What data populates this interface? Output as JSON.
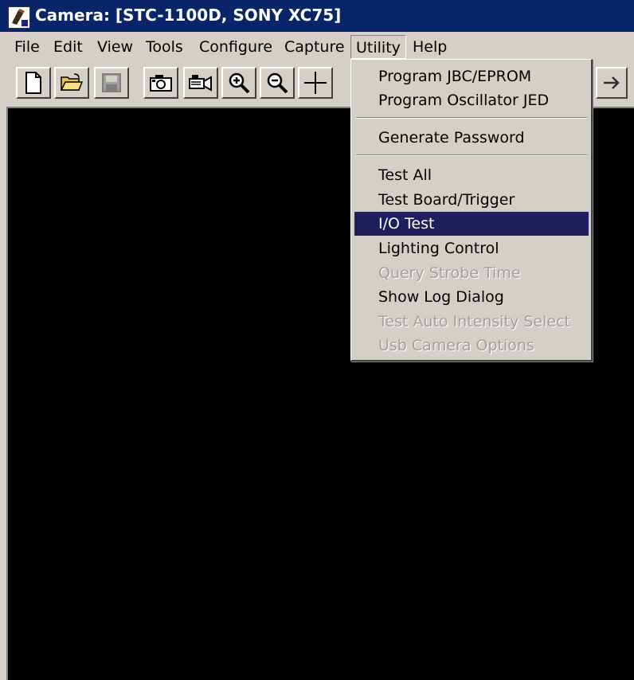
{
  "window": {
    "title": "Camera: [STC-1100D, SONY XC75]"
  },
  "menubar": {
    "items": [
      "File",
      "Edit",
      "View",
      "Tools",
      "Configure",
      "Capture",
      "Utility",
      "Help"
    ],
    "open_menu": "Utility"
  },
  "toolbar": {
    "buttons": [
      "new-icon",
      "open-folder-icon",
      "save-icon",
      "camera-snapshot-icon",
      "camera-video-icon",
      "zoom-in-icon",
      "zoom-out-icon",
      "crosshair-icon",
      "arrow-right-icon"
    ]
  },
  "utility_menu": {
    "items": [
      {
        "label": "Program JBC/EPROM",
        "enabled": true
      },
      {
        "label": "Program Oscillator JED",
        "enabled": true
      },
      {
        "label": "Generate Password",
        "enabled": true
      },
      {
        "label": "Test All",
        "enabled": true
      },
      {
        "label": "Test Board/Trigger",
        "enabled": true
      },
      {
        "label": "I/O Test",
        "enabled": true,
        "selected": true
      },
      {
        "label": "Lighting Control",
        "enabled": true
      },
      {
        "label": "Query Strobe Time",
        "enabled": false
      },
      {
        "label": "Show Log Dialog",
        "enabled": true
      },
      {
        "label": "Test Auto Intensity Select",
        "enabled": false
      },
      {
        "label": "Usb Camera Options",
        "enabled": false
      }
    ]
  },
  "colors": {
    "title_bar": "#0a246a",
    "menu_selection": "#1f1f5e",
    "window_face": "#d4d0c8",
    "viewport": "#000000"
  }
}
